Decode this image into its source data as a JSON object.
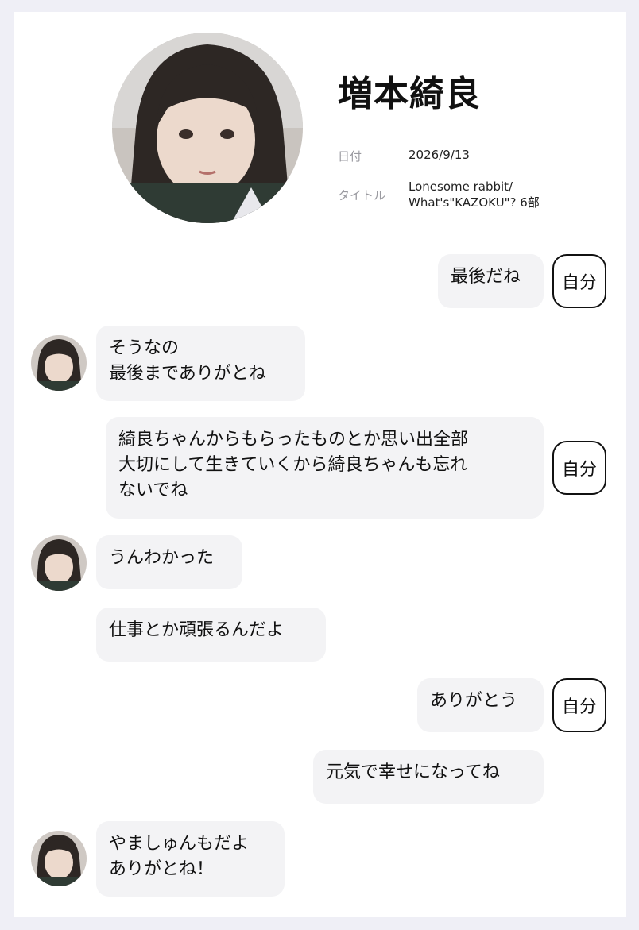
{
  "profile": {
    "name": "増本綺良",
    "date_label": "日付",
    "date_value": "2026/9/13",
    "title_label": "タイトル",
    "title_value": "Lonesome rabbit/\nWhat's\"KAZOKU\"? 6部"
  },
  "self_tag": "自分",
  "messages": [
    {
      "sender": "self",
      "text": "最後だね"
    },
    {
      "sender": "other",
      "text": "そうなの\n最後までありがとね"
    },
    {
      "sender": "self",
      "text": "綺良ちゃんからもらったものとか思い出全部\n大切にして生きていくから綺良ちゃんも忘れ\nないでね"
    },
    {
      "sender": "other",
      "text": "うんわかった"
    },
    {
      "sender": "other",
      "text": "仕事とか頑張るんだよ"
    },
    {
      "sender": "self",
      "text": "ありがとう"
    },
    {
      "sender": "self",
      "text": "元気で幸せになってね"
    },
    {
      "sender": "other",
      "text": "やましゅんもだよ\nありがとね！"
    }
  ],
  "icons": {
    "profile_photo": "profile-photo",
    "avatar": "avatar-photo"
  }
}
